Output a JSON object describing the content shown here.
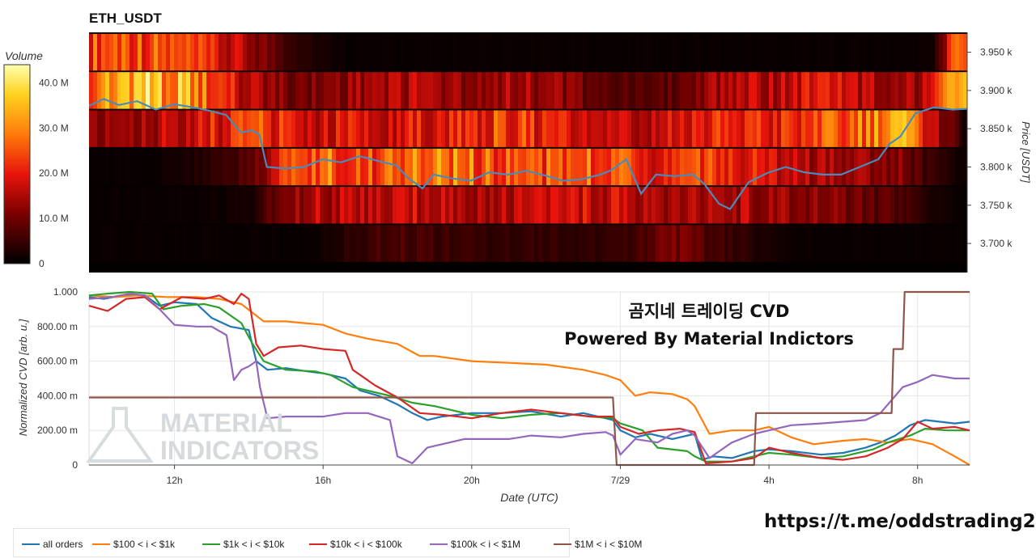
{
  "pair_title": "ETH_USDT",
  "colorbar": {
    "title": "Volume",
    "ticks": [
      "40.0 M",
      "30.0 M",
      "20.0 M",
      "10.0 M",
      "0"
    ],
    "tick_values": [
      40,
      30,
      20,
      10,
      0
    ],
    "max": 44
  },
  "caption": {
    "line1": "곰지네 트레이딩 CVD",
    "line2": "Powered By Material Indictors"
  },
  "link_text": "https://t.me/oddstrading2",
  "watermark": {
    "line1": "MATERIAL",
    "line2": "INDICATORS"
  },
  "chart_data": [
    {
      "type": "heatmap",
      "title": "ETH_USDT",
      "ylabel": "Price [USDT]",
      "y_ticks": [
        {
          "label": "3.950 k",
          "value": 3950
        },
        {
          "label": "3.900 k",
          "value": 3900
        },
        {
          "label": "3.850 k",
          "value": 3850
        },
        {
          "label": "3.800 k",
          "value": 3800
        },
        {
          "label": "3.750 k",
          "value": 3750
        },
        {
          "label": "3.700 k",
          "value": 3700
        }
      ],
      "ylim": [
        3662,
        3976
      ],
      "price_bands": [
        3950,
        3900,
        3850,
        3800,
        3750,
        3700
      ],
      "band_profile": [
        [
          0.55,
          0.6,
          0.55,
          0.5,
          0.4,
          0.3,
          0.15,
          0.05,
          0.02,
          0.02,
          0.02,
          0.02,
          0.02,
          0.02,
          0.02,
          0.02,
          0.02,
          0.02,
          0.02,
          0.02,
          0.02,
          0.02,
          0.02,
          0.02,
          0.02,
          0.02,
          0.03,
          0.8
        ],
        [
          0.6,
          0.85,
          0.8,
          0.7,
          0.5,
          0.35,
          0.25,
          0.25,
          0.3,
          0.35,
          0.35,
          0.3,
          0.3,
          0.35,
          0.3,
          0.25,
          0.2,
          0.15,
          0.2,
          0.3,
          0.4,
          0.35,
          0.4,
          0.45,
          0.35,
          0.3,
          0.35,
          0.85
        ],
        [
          0.25,
          0.3,
          0.35,
          0.4,
          0.45,
          0.55,
          0.45,
          0.4,
          0.45,
          0.4,
          0.45,
          0.5,
          0.5,
          0.55,
          0.45,
          0.4,
          0.35,
          0.35,
          0.4,
          0.45,
          0.5,
          0.45,
          0.5,
          0.55,
          0.6,
          0.7,
          0.4,
          0.05
        ],
        [
          0.02,
          0.02,
          0.02,
          0.05,
          0.1,
          0.2,
          0.55,
          0.6,
          0.6,
          0.55,
          0.6,
          0.65,
          0.6,
          0.55,
          0.55,
          0.6,
          0.55,
          0.5,
          0.45,
          0.5,
          0.45,
          0.4,
          0.35,
          0.3,
          0.3,
          0.25,
          0.1,
          0.02
        ],
        [
          0.02,
          0.02,
          0.02,
          0.02,
          0.03,
          0.05,
          0.3,
          0.35,
          0.35,
          0.35,
          0.4,
          0.4,
          0.35,
          0.35,
          0.35,
          0.4,
          0.4,
          0.35,
          0.35,
          0.35,
          0.35,
          0.3,
          0.3,
          0.25,
          0.2,
          0.15,
          0.05,
          0.02
        ],
        [
          0.02,
          0.02,
          0.02,
          0.02,
          0.02,
          0.02,
          0.02,
          0.02,
          0.1,
          0.15,
          0.15,
          0.12,
          0.1,
          0.1,
          0.1,
          0.1,
          0.1,
          0.15,
          0.25,
          0.15,
          0.1,
          0.05,
          0.02,
          0.02,
          0.02,
          0.02,
          0.02,
          0.02
        ]
      ],
      "x_range_hours": [
        9.7,
        33.4
      ],
      "price_x": [
        9.7,
        10.1,
        10.5,
        11.0,
        11.5,
        12.0,
        12.5,
        13.0,
        13.4,
        13.8,
        14.1,
        14.3,
        14.5,
        15.0,
        15.5,
        16.0,
        16.5,
        17.0,
        17.5,
        18.0,
        18.3,
        18.7,
        19.0,
        19.5,
        20.0,
        20.5,
        21.0,
        21.5,
        22.0,
        22.5,
        23.0,
        23.5,
        23.8,
        24.2,
        24.6,
        25.0,
        25.5,
        26.0,
        26.3,
        26.7,
        27.0,
        27.5,
        28.0,
        28.5,
        29.0,
        29.5,
        30.0,
        30.5,
        31.0,
        31.3,
        31.6,
        32.0,
        32.5,
        33.0,
        33.4
      ],
      "price_y": [
        3880,
        3889,
        3881,
        3886,
        3875,
        3882,
        3878,
        3873,
        3868,
        3845,
        3848,
        3842,
        3800,
        3798,
        3800,
        3810,
        3806,
        3814,
        3808,
        3802,
        3786,
        3772,
        3790,
        3785,
        3782,
        3793,
        3790,
        3795,
        3789,
        3782,
        3784,
        3790,
        3796,
        3810,
        3765,
        3790,
        3788,
        3790,
        3778,
        3752,
        3745,
        3780,
        3792,
        3800,
        3793,
        3790,
        3790,
        3800,
        3810,
        3830,
        3840,
        3870,
        3878,
        3875,
        3876
      ]
    },
    {
      "type": "line",
      "xlabel": "Date (UTC)",
      "ylabel": "Normalized CVD [arb. u.]",
      "x_ticks": [
        {
          "label": "12h",
          "value": 12
        },
        {
          "label": "16h",
          "value": 16
        },
        {
          "label": "20h",
          "value": 20
        },
        {
          "label": "7/29",
          "value": 24
        },
        {
          "label": "4h",
          "value": 28
        },
        {
          "label": "8h",
          "value": 32
        }
      ],
      "y_ticks": [
        {
          "label": "1.000",
          "value": 1.0
        },
        {
          "label": "800.00 m",
          "value": 0.8
        },
        {
          "label": "600.00 m",
          "value": 0.6
        },
        {
          "label": "400.00 m",
          "value": 0.4
        },
        {
          "label": "200.00 m",
          "value": 0.2
        },
        {
          "label": "0",
          "value": 0
        }
      ],
      "xlim": [
        9.7,
        33.4
      ],
      "ylim": [
        0,
        1
      ],
      "legend_position": "bottom",
      "series": [
        {
          "name": "all orders",
          "color": "#1f77b4",
          "x": [
            9.7,
            10.1,
            10.6,
            11.2,
            11.6,
            12.0,
            12.6,
            13.0,
            13.5,
            14.0,
            14.2,
            14.5,
            15.0,
            15.6,
            16.0,
            16.6,
            17.0,
            17.5,
            18.0,
            18.4,
            18.8,
            19.2,
            20.0,
            20.8,
            21.6,
            22.4,
            23.0,
            23.6,
            23.8,
            24.0,
            24.4,
            24.8,
            25.4,
            26.0,
            26.2,
            26.5,
            27.0,
            27.6,
            28.0,
            28.6,
            29.4,
            30.0,
            30.6,
            31.0,
            31.4,
            31.8,
            32.2,
            32.6,
            33.0,
            33.4
          ],
          "y": [
            0.97,
            0.96,
            0.98,
            0.98,
            0.92,
            0.94,
            0.93,
            0.85,
            0.8,
            0.78,
            0.6,
            0.55,
            0.56,
            0.54,
            0.53,
            0.5,
            0.43,
            0.4,
            0.35,
            0.3,
            0.26,
            0.28,
            0.3,
            0.3,
            0.31,
            0.28,
            0.3,
            0.27,
            0.26,
            0.2,
            0.16,
            0.18,
            0.15,
            0.18,
            0.03,
            0.05,
            0.04,
            0.08,
            0.09,
            0.08,
            0.06,
            0.07,
            0.1,
            0.13,
            0.17,
            0.23,
            0.26,
            0.25,
            0.24,
            0.25
          ]
        },
        {
          "name": "$100 < i < $1k",
          "color": "#ff7f0e",
          "x": [
            9.7,
            10.4,
            11.0,
            11.8,
            12.6,
            13.2,
            13.8,
            14.4,
            15.0,
            16.0,
            16.6,
            17.2,
            18.0,
            18.6,
            19.0,
            20.0,
            21.0,
            22.0,
            23.0,
            23.6,
            24.0,
            24.4,
            24.8,
            25.4,
            25.8,
            26.0,
            26.4,
            27.0,
            27.6,
            28.0,
            28.6,
            29.2,
            30.0,
            30.6,
            31.2,
            31.8,
            32.4,
            33.0,
            33.4
          ],
          "y": [
            0.98,
            0.97,
            0.98,
            0.97,
            0.97,
            0.96,
            0.93,
            0.83,
            0.83,
            0.81,
            0.76,
            0.73,
            0.7,
            0.63,
            0.63,
            0.6,
            0.59,
            0.58,
            0.55,
            0.52,
            0.49,
            0.4,
            0.42,
            0.41,
            0.38,
            0.34,
            0.18,
            0.2,
            0.2,
            0.22,
            0.16,
            0.12,
            0.14,
            0.15,
            0.13,
            0.15,
            0.12,
            0.05,
            0.0
          ]
        },
        {
          "name": "$1k < i < $10k",
          "color": "#2ca02c",
          "x": [
            9.7,
            10.2,
            10.8,
            11.4,
            11.7,
            12.2,
            12.8,
            13.2,
            13.8,
            14.1,
            14.4,
            15.0,
            15.8,
            16.2,
            16.8,
            17.2,
            17.8,
            18.4,
            19.0,
            20.0,
            20.8,
            21.6,
            22.4,
            23.2,
            23.8,
            24.0,
            24.6,
            25.0,
            25.8,
            26.0,
            26.3,
            27.0,
            27.6,
            28.0,
            28.6,
            29.4,
            30.0,
            30.8,
            31.2,
            31.8,
            32.2,
            32.8,
            33.4
          ],
          "y": [
            0.98,
            0.99,
            1.0,
            0.99,
            0.9,
            0.92,
            0.93,
            0.91,
            0.82,
            0.7,
            0.6,
            0.55,
            0.54,
            0.52,
            0.45,
            0.43,
            0.4,
            0.36,
            0.34,
            0.29,
            0.27,
            0.29,
            0.3,
            0.28,
            0.27,
            0.24,
            0.2,
            0.1,
            0.08,
            0.05,
            0.02,
            0.02,
            0.05,
            0.07,
            0.06,
            0.04,
            0.05,
            0.09,
            0.13,
            0.17,
            0.21,
            0.2,
            0.2
          ]
        },
        {
          "name": "$10k < i < $100k",
          "color": "#d62728",
          "x": [
            9.7,
            10.2,
            10.7,
            11.2,
            11.6,
            12.2,
            12.8,
            13.2,
            13.6,
            13.8,
            14.0,
            14.2,
            14.4,
            14.8,
            15.4,
            16.0,
            16.6,
            16.8,
            17.4,
            18.0,
            18.6,
            19.2,
            20.0,
            20.8,
            21.6,
            22.4,
            23.2,
            23.8,
            24.0,
            24.5,
            25.0,
            25.6,
            26.0,
            26.3,
            27.0,
            27.6,
            28.0,
            28.6,
            29.4,
            30.0,
            30.6,
            31.2,
            31.6,
            32.0,
            32.4,
            33.0,
            33.4
          ],
          "y": [
            0.92,
            0.89,
            0.96,
            0.97,
            0.9,
            0.97,
            0.96,
            0.98,
            0.93,
            0.99,
            0.96,
            0.7,
            0.63,
            0.68,
            0.69,
            0.67,
            0.66,
            0.55,
            0.46,
            0.39,
            0.3,
            0.29,
            0.27,
            0.3,
            0.32,
            0.3,
            0.28,
            0.28,
            0.22,
            0.18,
            0.2,
            0.21,
            0.19,
            0.01,
            0.02,
            0.04,
            0.1,
            0.07,
            0.04,
            0.03,
            0.05,
            0.1,
            0.15,
            0.25,
            0.21,
            0.22,
            0.2
          ]
        },
        {
          "name": "$100k < i < $1M",
          "color": "#9467bd",
          "x": [
            9.7,
            10.3,
            10.8,
            11.2,
            11.6,
            12.0,
            12.6,
            13.0,
            13.4,
            13.6,
            13.8,
            14.0,
            14.2,
            14.3,
            14.5,
            15.0,
            16.0,
            16.6,
            17.2,
            17.8,
            18.0,
            18.4,
            18.8,
            19.2,
            19.8,
            20.4,
            21.0,
            21.6,
            22.4,
            23.0,
            23.6,
            23.8,
            24.0,
            24.4,
            25.0,
            25.4,
            25.8,
            26.0,
            26.4,
            27.0,
            27.6,
            28.0,
            28.6,
            29.4,
            30.0,
            30.6,
            31.0,
            31.4,
            31.6,
            32.0,
            32.4,
            33.0,
            33.4
          ],
          "y": [
            0.96,
            0.97,
            0.99,
            0.98,
            0.9,
            0.81,
            0.8,
            0.8,
            0.75,
            0.49,
            0.55,
            0.57,
            0.6,
            0.45,
            0.27,
            0.28,
            0.28,
            0.3,
            0.3,
            0.26,
            0.05,
            0.01,
            0.1,
            0.12,
            0.15,
            0.15,
            0.15,
            0.17,
            0.16,
            0.18,
            0.19,
            0.17,
            0.06,
            0.15,
            0.13,
            0.18,
            0.2,
            0.17,
            0.04,
            0.13,
            0.18,
            0.2,
            0.23,
            0.24,
            0.25,
            0.26,
            0.3,
            0.4,
            0.45,
            0.48,
            0.52,
            0.5,
            0.5
          ]
        },
        {
          "name": "$1M < i < $10M",
          "color": "#8c564b",
          "x": [
            9.7,
            23.8,
            23.9,
            26.0,
            26.05,
            27.6,
            27.65,
            30.0,
            30.05,
            31.3,
            31.35,
            31.6,
            31.65,
            33.4
          ],
          "y": [
            0.39,
            0.39,
            0.0,
            0.0,
            0.0,
            0.0,
            0.3,
            0.3,
            0.3,
            0.3,
            0.67,
            0.67,
            1.0,
            1.0
          ]
        }
      ]
    }
  ]
}
